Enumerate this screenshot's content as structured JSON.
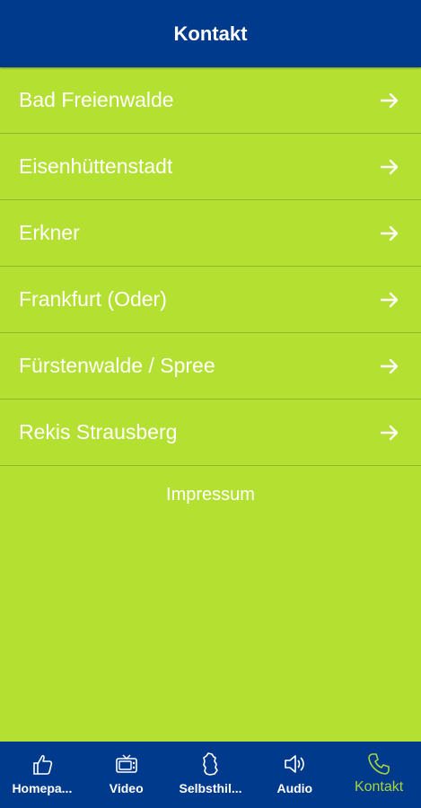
{
  "header": {
    "title": "Kontakt"
  },
  "locations": [
    {
      "label": "Bad Freienwalde"
    },
    {
      "label": "Eisenhüttenstadt"
    },
    {
      "label": "Erkner"
    },
    {
      "label": "Frankfurt (Oder)"
    },
    {
      "label": "Fürstenwalde / Spree"
    },
    {
      "label": "Rekis Strausberg"
    }
  ],
  "impressum": "Impressum",
  "tabs": [
    {
      "label": "Homepa...",
      "icon": "thumbs-up-icon"
    },
    {
      "label": "Video",
      "icon": "tv-icon"
    },
    {
      "label": "Selbsthil...",
      "icon": "germany-map-icon"
    },
    {
      "label": "Audio",
      "icon": "speaker-icon"
    },
    {
      "label": "Kontakt",
      "icon": "phone-icon",
      "active": true
    }
  ],
  "colors": {
    "header": "#003a8c",
    "background": "#b4e031",
    "active_tab": "#a7d43a"
  }
}
